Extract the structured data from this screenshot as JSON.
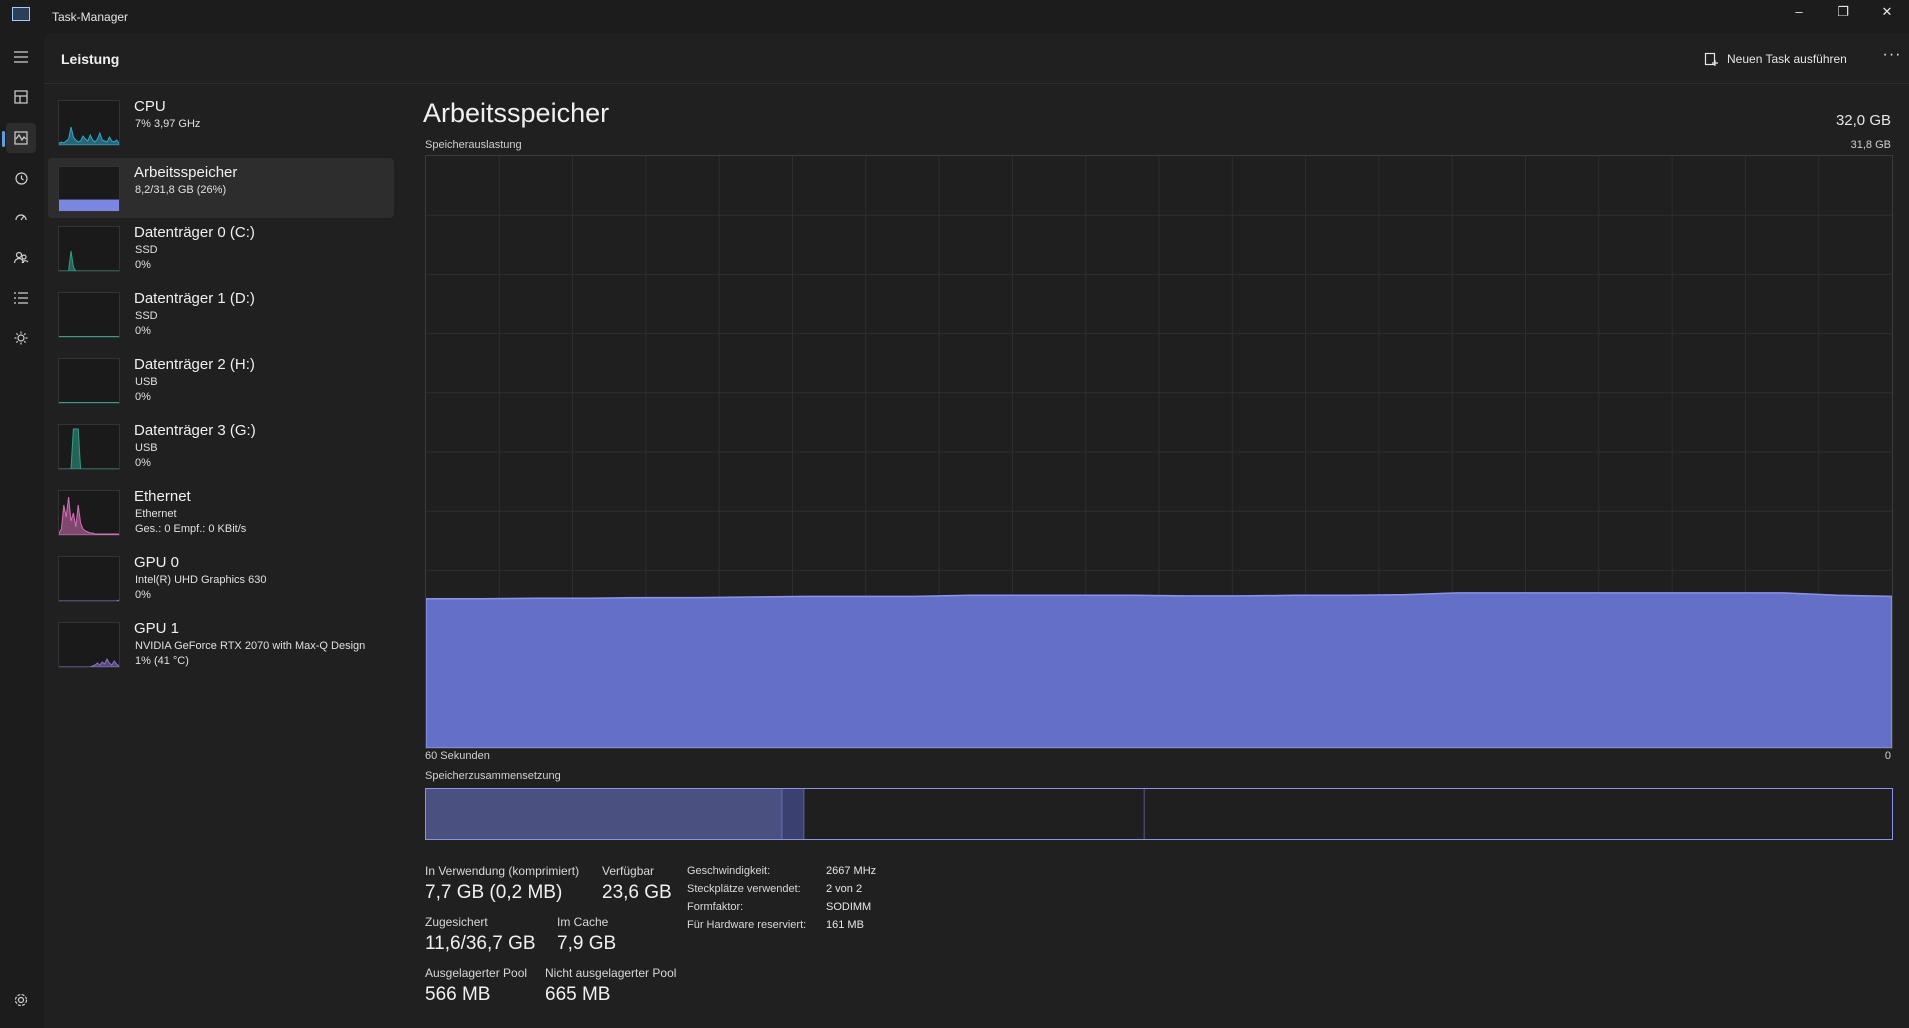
{
  "window": {
    "title": "Task-Manager",
    "controls": {
      "minimize": "–",
      "restore": "❐",
      "close": "✕"
    }
  },
  "nav": {
    "items": [
      {
        "name": "hamburger-menu-icon"
      },
      {
        "name": "processes-icon"
      },
      {
        "name": "performance-icon",
        "active": true
      },
      {
        "name": "app-history-icon"
      },
      {
        "name": "startup-apps-icon"
      },
      {
        "name": "users-icon"
      },
      {
        "name": "details-icon"
      },
      {
        "name": "services-icon"
      }
    ],
    "settings": {
      "name": "settings-gear-icon"
    }
  },
  "header": {
    "title": "Leistung",
    "new_task_label": "Neuen Task ausführen",
    "more_label": "···"
  },
  "devices": [
    {
      "name": "CPU",
      "sub1": "7% 3,97 GHz",
      "sub2": "",
      "color": "#2fa8c9",
      "kind": "cpu"
    },
    {
      "name": "Arbeitsspeicher",
      "sub1": "8,2/31,8 GB (26%)",
      "sub2": "",
      "color": "#7a86e0",
      "kind": "memory",
      "selected": true,
      "level": 0.26
    },
    {
      "name": "Datenträger 0 (C:)",
      "sub1": "SSD",
      "sub2": "0%",
      "color": "#30a08a",
      "kind": "disk0"
    },
    {
      "name": "Datenträger 1 (D:)",
      "sub1": "SSD",
      "sub2": "0%",
      "color": "#30a08a",
      "kind": "disk"
    },
    {
      "name": "Datenträger 2 (H:)",
      "sub1": "USB",
      "sub2": "0%",
      "color": "#30a08a",
      "kind": "disk"
    },
    {
      "name": "Datenträger 3 (G:)",
      "sub1": "USB",
      "sub2": "0%",
      "color": "#30a08a",
      "kind": "disk3"
    },
    {
      "name": "Ethernet",
      "sub1": "Ethernet",
      "sub2": "Ges.: 0 Empf.: 0 KBit/s",
      "color": "#d36fb4",
      "kind": "ethernet"
    },
    {
      "name": "GPU 0",
      "sub1": "Intel(R) UHD Graphics 630",
      "sub2": "0%",
      "color": "#8a73c9",
      "kind": "gpu0"
    },
    {
      "name": "GPU 1",
      "sub1": "NVIDIA GeForce RTX 2070 with Max-Q Design",
      "sub2": "1% (41 °C)",
      "color": "#8a73c9",
      "kind": "gpu1"
    }
  ],
  "detail": {
    "title": "Arbeitsspeicher",
    "total": "32,0 GB",
    "usage_label": "Speicherauslastung",
    "usage_max": "31,8 GB",
    "time_left": "60 Sekunden",
    "time_right": "0",
    "composition_label": "Speicherzusammensetzung",
    "accent": "#6470c7",
    "usage_series": [
      0.252,
      0.252,
      0.253,
      0.253,
      0.254,
      0.254,
      0.255,
      0.256,
      0.256,
      0.256,
      0.258,
      0.258,
      0.258,
      0.258,
      0.257,
      0.257,
      0.258,
      0.258,
      0.259,
      0.262,
      0.262,
      0.262,
      0.262,
      0.262,
      0.262,
      0.262,
      0.258,
      0.256
    ],
    "composition": {
      "in_use": 0.243,
      "modified": 0.015,
      "standby": 0.232,
      "free": 0.51
    }
  },
  "stats": {
    "in_use": {
      "label": "In Verwendung (komprimiert)",
      "value": "7,7 GB (0,2 MB)"
    },
    "available": {
      "label": "Verfügbar",
      "value": "23,6 GB"
    },
    "committed": {
      "label": "Zugesichert",
      "value": "11,6/36,7 GB"
    },
    "cached": {
      "label": "Im Cache",
      "value": "7,9 GB"
    },
    "paged_pool": {
      "label": "Ausgelagerter Pool",
      "value": "566 MB"
    },
    "nonpaged_pool": {
      "label": "Nicht ausgelagerter Pool",
      "value": "665 MB"
    }
  },
  "specs": {
    "speed": {
      "label": "Geschwindigkeit:",
      "value": "2667 MHz"
    },
    "slots": {
      "label": "Steckplätze verwendet:",
      "value": "2 von 2"
    },
    "form": {
      "label": "Formfaktor:",
      "value": "SODIMM"
    },
    "reserved": {
      "label": "Für Hardware reserviert:",
      "value": "161 MB"
    }
  }
}
